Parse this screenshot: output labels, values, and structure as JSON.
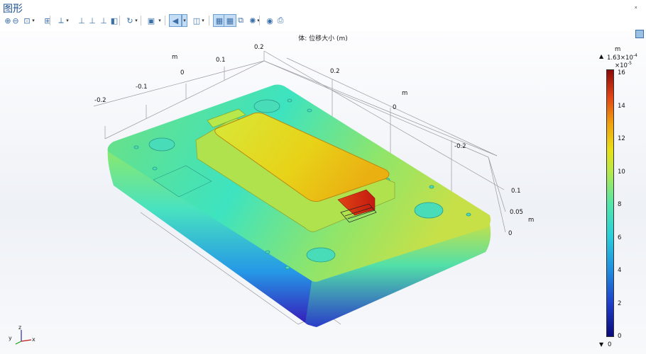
{
  "window": {
    "title": "图形",
    "pin_glyph": "ₓ"
  },
  "toolbar": {
    "buttons": [
      {
        "name": "zoom-in-icon",
        "glyph": "⊕"
      },
      {
        "name": "zoom-out-icon",
        "glyph": "⊖"
      },
      {
        "name": "zoom-box-icon",
        "glyph": "⊡"
      },
      {
        "name": "dropdown-icon",
        "glyph": "▾"
      },
      {
        "name": "zoom-extents-icon",
        "glyph": "⊞"
      },
      {
        "name": "axes-icon",
        "glyph": "⟂"
      },
      {
        "name": "dropdown-icon",
        "glyph": "▾"
      },
      {
        "name": "view-xy-icon",
        "glyph": "⊥"
      },
      {
        "name": "view-yz-icon",
        "glyph": "⊥"
      },
      {
        "name": "view-zx-icon",
        "glyph": "⊥"
      },
      {
        "name": "go-to-view-icon",
        "glyph": "◧"
      },
      {
        "name": "rotate-icon",
        "glyph": "↻"
      },
      {
        "name": "dropdown-icon",
        "glyph": "▾"
      },
      {
        "name": "select-all-icon",
        "glyph": "▣"
      },
      {
        "name": "dropdown-icon",
        "glyph": "▾"
      },
      {
        "name": "transparency-icon",
        "glyph": "◀"
      },
      {
        "name": "dropdown-icon",
        "glyph": "▾"
      },
      {
        "name": "wireframe-icon",
        "glyph": "◫"
      },
      {
        "name": "dropdown-icon",
        "glyph": "▾"
      },
      {
        "name": "grid-icon",
        "glyph": "▦"
      },
      {
        "name": "grid-axes-icon",
        "glyph": "▦"
      },
      {
        "name": "copy-icon",
        "glyph": "⧉"
      },
      {
        "name": "scene-light-icon",
        "glyph": "✺"
      },
      {
        "name": "dropdown-icon",
        "glyph": "▾"
      },
      {
        "name": "camera-icon",
        "glyph": "◉"
      },
      {
        "name": "print-icon",
        "glyph": "⎙"
      }
    ]
  },
  "plot": {
    "title": "体: 位移大小 (m)"
  },
  "axes": {
    "labels": [
      {
        "text": "m"
      },
      {
        "text": "0.2"
      },
      {
        "text": "0.1"
      },
      {
        "text": "0"
      },
      {
        "text": "-0.1"
      },
      {
        "text": "-0.2"
      },
      {
        "text": "0.2"
      },
      {
        "text": "m"
      },
      {
        "text": "0"
      },
      {
        "text": "-0.2"
      },
      {
        "text": "0.1"
      },
      {
        "text": "0.05"
      },
      {
        "text": "m"
      },
      {
        "text": "0"
      }
    ]
  },
  "colorbar": {
    "unit": "m",
    "max_label": "1.63×10",
    "max_exp": "-4",
    "scale": "×10",
    "scale_exp": "-5",
    "ticks": [
      "16",
      "14",
      "12",
      "10",
      "8",
      "6",
      "4",
      "2",
      "0"
    ],
    "min_label": "0",
    "colors": [
      "#0a0a7a",
      "#1e3cc8",
      "#1f8ee0",
      "#2bcfd8",
      "#55e6a8",
      "#b8e84a",
      "#e8e018",
      "#f0a010",
      "#e04414",
      "#8a0a0a"
    ]
  },
  "triad": {
    "x": "x",
    "y": "y",
    "z": "z"
  }
}
